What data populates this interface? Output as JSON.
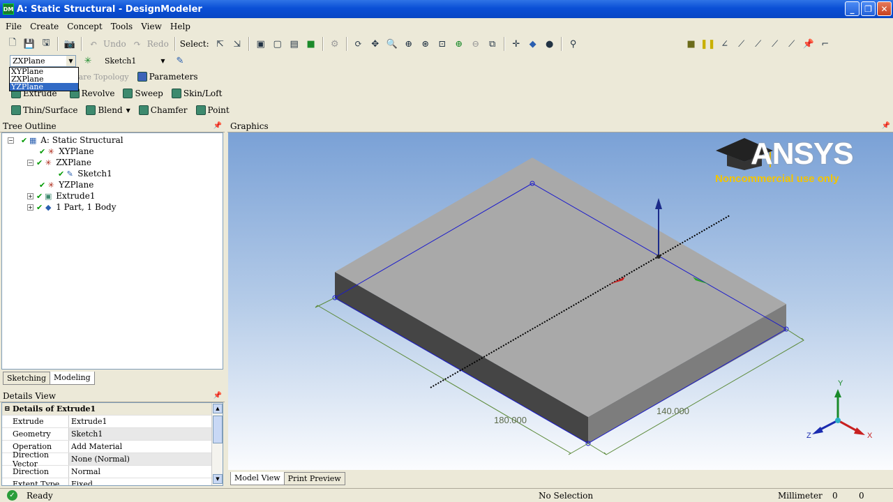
{
  "window": {
    "title": "A: Static Structural - DesignModeler",
    "app_icon": "DM"
  },
  "menu": [
    "File",
    "Create",
    "Concept",
    "Tools",
    "View",
    "Help"
  ],
  "toolbar1": {
    "undo": "Undo",
    "redo": "Redo",
    "select": "Select:"
  },
  "toolbar2": {
    "plane": "ZXPlane",
    "sketch": "Sketch1"
  },
  "plane_dropdown": {
    "options": [
      "XYPlane",
      "ZXPlane",
      "YZPlane"
    ],
    "selected_index": 2
  },
  "toolbar3": {
    "share_topology": "Share Topology",
    "parameters": "Parameters"
  },
  "toolbar4": {
    "extrude": "Extrude",
    "revolve": "Revolve",
    "sweep": "Sweep",
    "skin_loft": "Skin/Loft"
  },
  "toolbar5": {
    "thin_surface": "Thin/Surface",
    "blend": "Blend",
    "chamfer": "Chamfer",
    "point": "Point"
  },
  "tree": {
    "header": "Tree Outline",
    "nodes": [
      "A: Static Structural",
      "XYPlane",
      "ZXPlane",
      "Sketch1",
      "YZPlane",
      "Extrude1",
      "1 Part, 1 Body"
    ]
  },
  "tabs": {
    "sketching": "Sketching",
    "modeling": "Modeling"
  },
  "details": {
    "header": "Details View",
    "title": "Details of Extrude1",
    "rows": [
      [
        "Extrude",
        "Extrude1"
      ],
      [
        "Geometry",
        "Sketch1"
      ],
      [
        "Operation",
        "Add Material"
      ],
      [
        "Direction Vector",
        "None (Normal)"
      ],
      [
        "Direction",
        "Normal"
      ],
      [
        "Extent Type",
        "Fixed"
      ]
    ]
  },
  "graphics": {
    "header": "Graphics",
    "dim_length": "180.000",
    "dim_width": "140.000",
    "logo": "ANSYS",
    "logo_sub": "Noncommercial use only",
    "triad": {
      "x": "X",
      "y": "Y",
      "z": "Z"
    },
    "colors": {
      "plate_top": "#a9a9a9",
      "plate_front": "#454545",
      "plate_side": "#7d7d7d",
      "edge": "#1a1acc",
      "dim": "#5c8a3a"
    }
  },
  "view_tabs": {
    "model": "Model View",
    "print": "Print Preview"
  },
  "status": {
    "ready": "Ready",
    "selection": "No Selection",
    "units": "Millimeter",
    "v1": "0",
    "v2": "0"
  }
}
